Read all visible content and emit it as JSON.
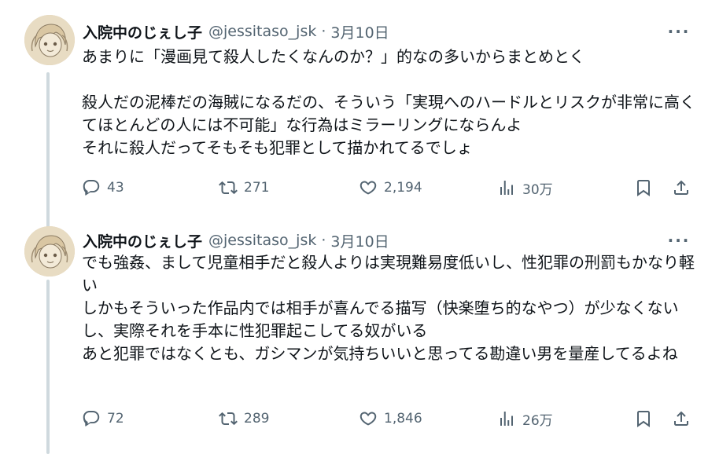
{
  "tweets": [
    {
      "author_name": "入院中のじぇし子",
      "handle": "@jessitaso_jsk",
      "date": "3月10日",
      "separator": "·",
      "more": "···",
      "text": "あまりに「漫画見て殺人したくなんのか？」的なの多いからまとめとく\n\n殺人だの泥棒だの海賊になるだの、そういう「実現へのハードルとリスクが非常に高くてほとんどの人には不可能」な行為はミラーリングにならんよ\nそれに殺人だってそもそも犯罪として描かれてるでしょ",
      "replies": "43",
      "retweets": "271",
      "likes": "2,194",
      "views": "30万"
    },
    {
      "author_name": "入院中のじぇし子",
      "handle": "@jessitaso_jsk",
      "date": "3月10日",
      "separator": "·",
      "more": "···",
      "text": "でも強姦、まして児童相手だと殺人よりは実現難易度低いし、性犯罪の刑罰もかなり軽い\nしかもそういった作品内では相手が喜んでる描写（快楽堕ち的なやつ）が少なくないし、実際それを手本に性犯罪起こしてる奴がいる\nあと犯罪ではなくとも、ガシマンが気持ちいいと思ってる勘違い男を量産してるよね",
      "replies": "72",
      "retweets": "289",
      "likes": "1,846",
      "views": "26万"
    }
  ],
  "icons": {
    "reply": "reply-icon",
    "retweet": "retweet-icon",
    "like": "heart-icon",
    "views": "views-chart-icon",
    "bookmark": "bookmark-icon",
    "share": "share-icon",
    "more": "more-icon"
  },
  "colors": {
    "text": "#0f1419",
    "secondary": "#536471",
    "thread_line": "#cfd9de"
  }
}
